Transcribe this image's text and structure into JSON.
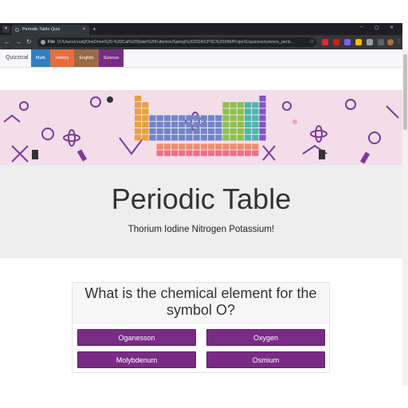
{
  "browser": {
    "tab_title": "Periodic Table Quiz",
    "tab_close": "×",
    "new_tab": "+",
    "url_scheme": "File",
    "url": "D:/Users/crusij/OneDrive%20-%20Cal%20State%20Fullerton/Spring%202024/CPSC%20349/Project1/quizzes/science_perio...",
    "window_controls": [
      "–",
      "▢",
      "✕"
    ]
  },
  "navbar": {
    "brand": "Quizzical",
    "links": [
      {
        "label": "Math",
        "color": "#2f7fc1"
      },
      {
        "label": "History",
        "color": "#e86d3a"
      },
      {
        "label": "English",
        "color": "#9a6a45"
      },
      {
        "label": "Science",
        "color": "#7a2b86"
      }
    ]
  },
  "hero": {
    "title": "Periodic Table",
    "subtitle": "Thorium Iodine Nitrogen Potassium!"
  },
  "quiz": {
    "question": "What is the chemical element for the symbol O?",
    "answers": [
      "Oganesson",
      "Oxygen",
      "Molybdenum",
      "Osmium"
    ]
  },
  "colors": {
    "accent": "#7a2b86",
    "banner_bg": "#f2dde9",
    "hero_bg": "#eeeeee"
  }
}
